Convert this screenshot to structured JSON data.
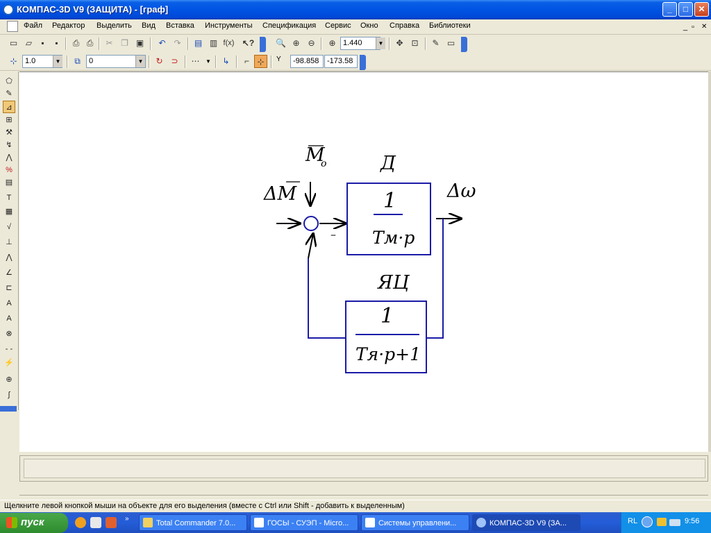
{
  "window": {
    "title": "КОМПАС-3D V9 (ЗАЩИТА) - [граф]",
    "controls": {
      "minimize": "_",
      "maximize": "□",
      "close": "✕"
    }
  },
  "menu": {
    "items": [
      "Файл",
      "Редактор",
      "Выделить",
      "Вид",
      "Вставка",
      "Инструменты",
      "Спецификация",
      "Сервис",
      "Окно",
      "Справка",
      "Библиотеки"
    ],
    "doc_controls": {
      "minimize": "_",
      "restore": "▫",
      "close": "✕"
    }
  },
  "toolbar1": {
    "zoom_value": "1.440"
  },
  "toolbar2": {
    "step_value": "1.0",
    "layer_value": "0",
    "coord_label": "Y",
    "coord_x": "-98.858",
    "coord_y": "-173.58"
  },
  "diagram": {
    "input_label": "ΔM",
    "disturbance_label": "M",
    "disturbance_subscript": "o",
    "block1_title": "Д",
    "block1_numerator": "1",
    "block1_denominator": "Tм·p",
    "output_label": "Δω",
    "block2_title": "ЯЦ",
    "block2_numerator": "1",
    "block2_denominator": "Tя·p+1",
    "sum_sign": "–",
    "colors": {
      "line": "#1a1aa8",
      "text": "#000000"
    }
  },
  "status": {
    "text": "Щелкните левой кнопкой мыши на объекте для его выделения (вместе с Ctrl или Shift - добавить к выделенным)"
  },
  "taskbar": {
    "start_label": "пуск",
    "tasks": [
      {
        "label": "Total Commander 7.0..."
      },
      {
        "label": "ГОСЫ - СУЭП - Micro..."
      },
      {
        "label": "Системы управлени..."
      },
      {
        "label": "КОМПАС-3D V9 (ЗА..."
      }
    ],
    "lang": "RL",
    "clock": "9:56"
  }
}
